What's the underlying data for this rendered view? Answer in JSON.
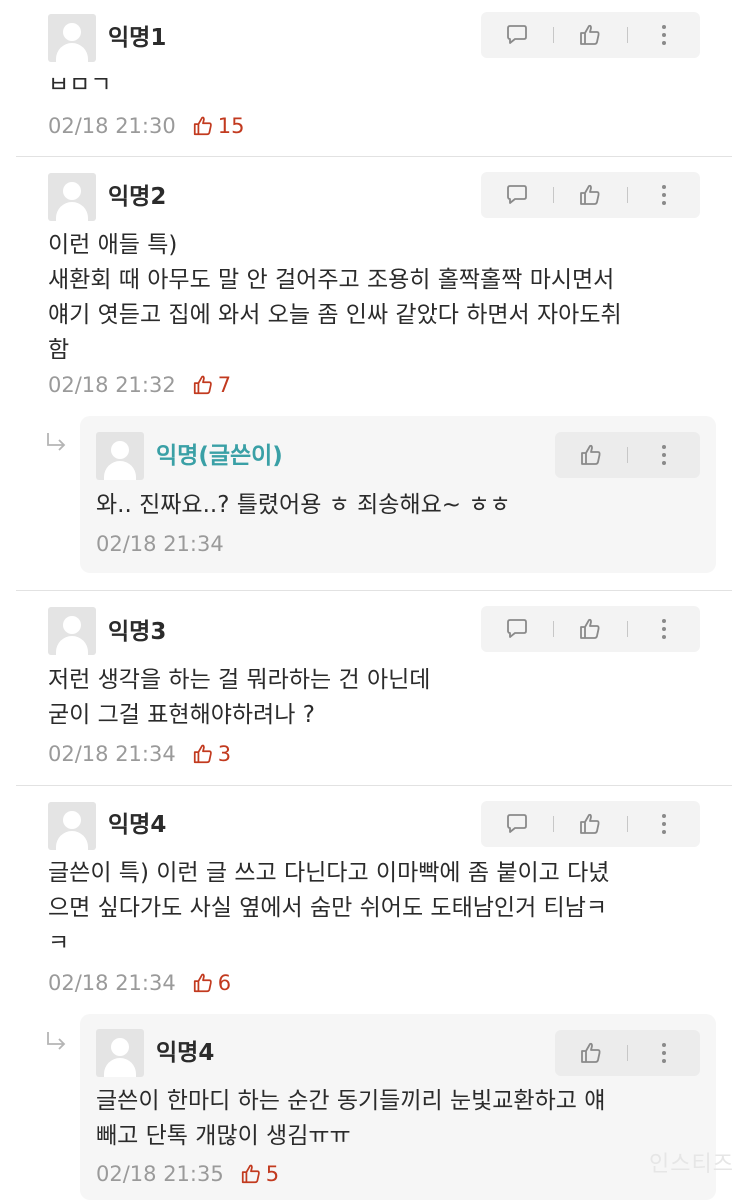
{
  "comments": [
    {
      "name": "익명1",
      "body": "ㅂㅁㄱ",
      "date": "02/18 21:30",
      "likes": "15"
    },
    {
      "name": "익명2",
      "body": "이런 애들 특)\n새환회 때 아무도 말 안 걸어주고 조용히 홀짝홀짝 마시면서\n얘기 엿듣고 집에 와서 오늘 좀 인싸 같았다 하면서 자아도취\n함",
      "date": "02/18 21:32",
      "likes": "7"
    },
    {
      "name": "익명(글쓴이)",
      "body": "와.. 진짜요..? 틀렸어용 ㅎ 죄송해요~ ㅎㅎ",
      "date": "02/18 21:34"
    },
    {
      "name": "익명3",
      "body": "저런 생각을 하는 걸 뭐라하는 건 아닌데\n굳이 그걸 표현해야하려나 ?",
      "date": "02/18 21:34",
      "likes": "3"
    },
    {
      "name": "익명4",
      "body": "글쓴이 특) 이런 글 쓰고 다닌다고 이마빡에 좀 붙이고 다녔\n으면 싶다가도 사실 옆에서 숨만 쉬어도 도태남인거 티남ㅋ\nㅋ",
      "date": "02/18 21:34",
      "likes": "6"
    },
    {
      "name": "익명4",
      "body": "글쓴이 한마디 하는 순간 동기들끼리 눈빛교환하고 얘\n빼고 단톡 개많이 생김ㅠㅠ",
      "date": "02/18 21:35",
      "likes": "5"
    }
  ],
  "icons": {
    "reply": "speech-bubble-icon",
    "like": "thumbs-up-icon",
    "more": "vertical-dots-icon",
    "reply_indicator": "reply-arrow-icon",
    "avatar": "default-avatar-icon"
  },
  "colors": {
    "like_count": "#c23a1f",
    "author_name": "#3aa0a6",
    "meta": "#9a9a9a"
  },
  "watermark": "인스티즈"
}
